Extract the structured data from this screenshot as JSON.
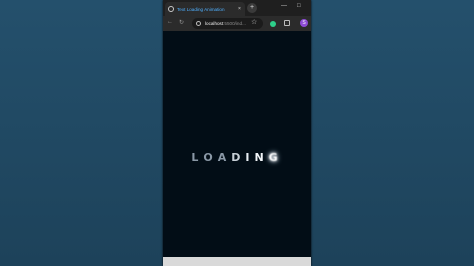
{
  "browser": {
    "tab": {
      "title": "Text Loading Animation",
      "close": "×"
    },
    "new_tab": "+",
    "window": {
      "minimize": "—",
      "maximize": "□"
    },
    "address": {
      "host": "localhost",
      "rest": ":5500/ind..."
    },
    "avatar_letter": "S"
  },
  "page": {
    "letters": [
      {
        "char": "L",
        "color": "#8a98a6",
        "glow": false
      },
      {
        "char": "O",
        "color": "#8a98a6",
        "glow": false
      },
      {
        "char": "A",
        "color": "#8a98a6",
        "glow": false
      },
      {
        "char": "D",
        "color": "#c7cfd6",
        "glow": false
      },
      {
        "char": "I",
        "color": "#e8eef3",
        "glow": false
      },
      {
        "char": "N",
        "color": "#f2f6f9",
        "glow": false
      },
      {
        "char": "G",
        "color": "#ffffff",
        "glow": true
      }
    ]
  }
}
